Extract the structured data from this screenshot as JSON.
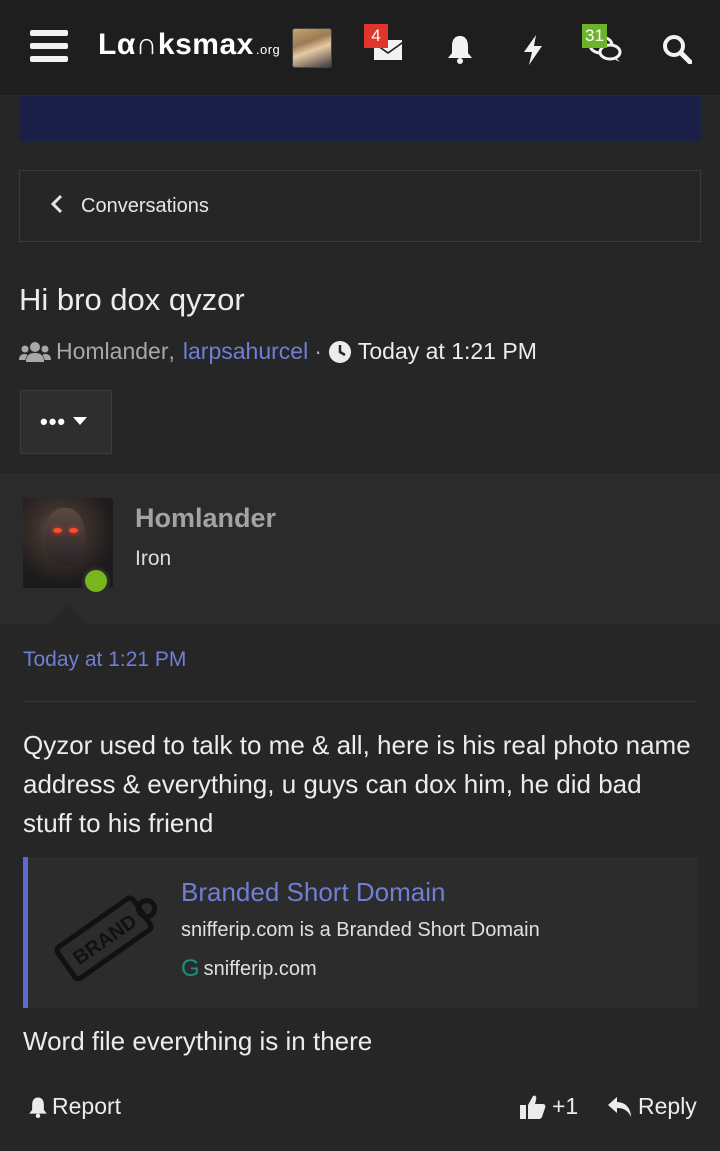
{
  "header": {
    "logo_text": "Lα∩ksmax",
    "logo_suffix": ".org",
    "messages_badge": "4",
    "alerts_label": "",
    "conversations_badge": "31",
    "icons": [
      "menu-icon",
      "avatar",
      "inbox-icon",
      "bell-icon",
      "bolt-icon",
      "chat-icon",
      "search-icon"
    ]
  },
  "breadcrumb": {
    "label": "Conversations"
  },
  "conversation": {
    "title": "Hi bro dox qyzor",
    "participant_1": "Homlander",
    "separator_comma": ",",
    "participant_2": "larpsahurcel",
    "dot": "·",
    "started": "Today at 1:21 PM"
  },
  "message": {
    "username": "Homlander",
    "user_title": "Iron",
    "timestamp": "Today at 1:21 PM",
    "text": "Qyzor used to talk to me & all, here is his real photo name address & everything, u guys can dox him, he did bad stuff to his friend",
    "embed": {
      "title": "Branded Short Domain",
      "description": "snifferip.com is a Branded Short Domain",
      "site_icon": "G",
      "site": "snifferip.com",
      "thumb_text": "BRAND"
    },
    "text2": "Word file everything is in there"
  },
  "actions": {
    "report": "Report",
    "like_count": "+1",
    "reply": "Reply"
  },
  "colors": {
    "accent_link": "#6f7fd6",
    "online": "#79b51c",
    "badge_red": "#e0352d",
    "badge_green": "#6cb32a"
  }
}
